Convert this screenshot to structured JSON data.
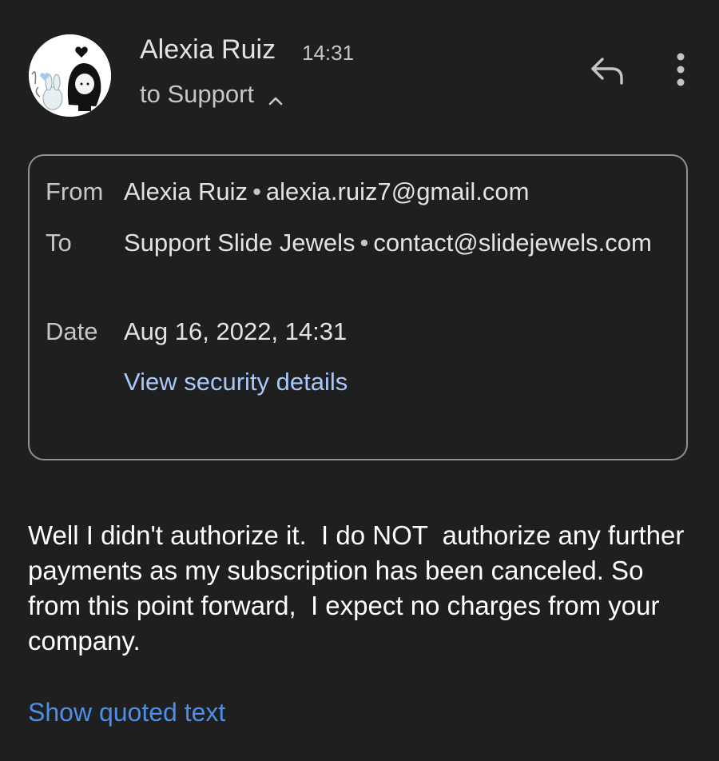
{
  "header": {
    "sender_name": "Alexia Ruiz",
    "time": "14:31",
    "recipient_summary": "to Support",
    "avatar_icon": "anime-avatar",
    "reply_icon": "reply-icon",
    "more_icon": "more-vert-icon"
  },
  "details": {
    "from_label": "From",
    "from_name": "Alexia Ruiz",
    "from_email": "alexia.ruiz7@gmail.com",
    "to_label": "To",
    "to_name": "Support Slide Jewels",
    "to_email": "contact@slidejewels.com",
    "date_label": "Date",
    "date_value": "Aug 16, 2022, 14:31",
    "security_link": "View security details"
  },
  "message": {
    "body": "Well I didn't authorize it.  I do NOT  authorize any further payments as my subscription has been canceled. So from this point forward,  I expect no charges from your company.",
    "show_quoted": "Show quoted text"
  },
  "colors": {
    "background": "#1f1f1f",
    "link_light": "#a8c7fa",
    "link_blue": "#4c8ee8",
    "border": "#8e918f"
  }
}
